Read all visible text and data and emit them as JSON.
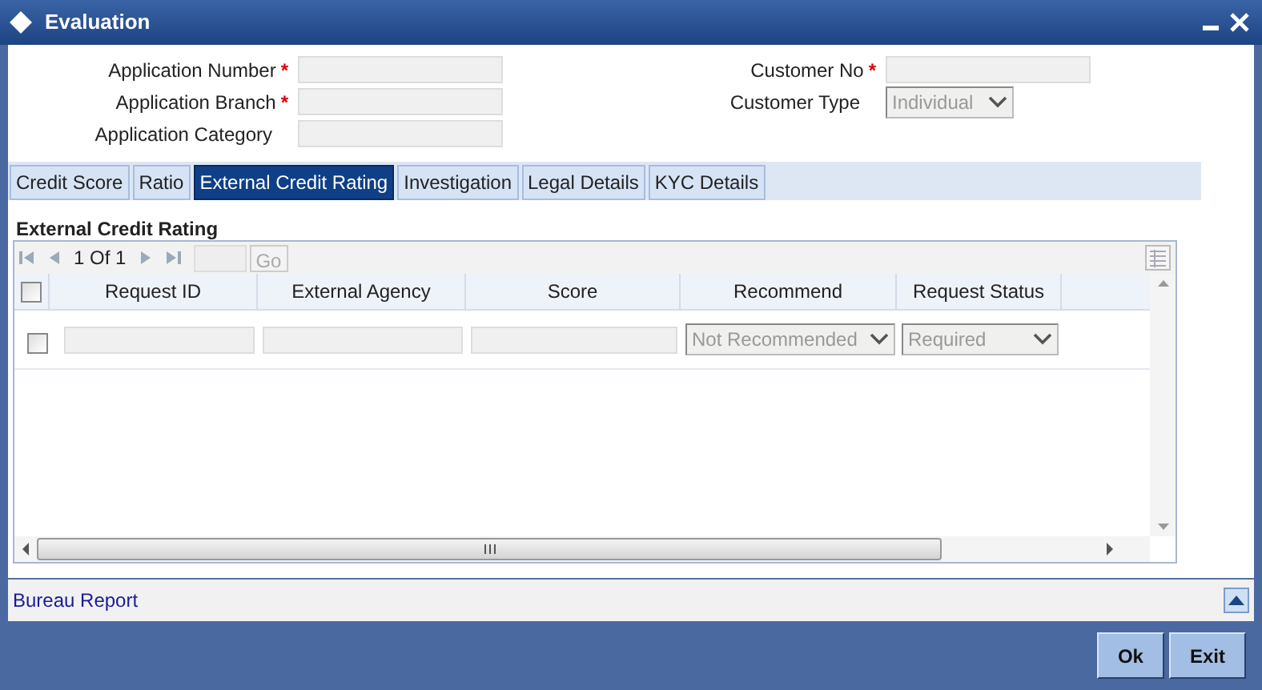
{
  "window": {
    "title": "Evaluation"
  },
  "fields_left": [
    {
      "label": "Application Number",
      "required_mark": "*",
      "kind": "text"
    },
    {
      "label": "Application Branch",
      "required_mark": "*",
      "kind": "text"
    },
    {
      "label": "Application Category",
      "kind": "text"
    }
  ],
  "fields_right": [
    {
      "label": "Customer No",
      "required_mark": "*",
      "kind": "text"
    },
    {
      "label": "Customer Type",
      "kind": "select",
      "value": "Individual",
      "disabled": true
    }
  ],
  "tabs": [
    {
      "label": "Credit Score",
      "selected": false
    },
    {
      "label": "Ratio",
      "selected": false
    },
    {
      "label": "External Credit Rating",
      "selected": true
    },
    {
      "label": "Investigation",
      "selected": false
    },
    {
      "label": "Legal Details",
      "selected": false
    },
    {
      "label": "KYC Details",
      "selected": false
    }
  ],
  "section_title": "External Credit Rating",
  "pager": {
    "text": "1 Of 1",
    "go": "Go"
  },
  "table": {
    "select_all_checked": false,
    "columns": [
      "Request ID",
      "External Agency",
      "Score",
      "Recommend",
      "Request Status"
    ],
    "rows": [
      {
        "checked": false,
        "cells": [
          {
            "kind": "text"
          },
          {
            "kind": "text"
          },
          {
            "kind": "text"
          },
          {
            "kind": "select",
            "value": "Not Recommended",
            "disabled": true
          },
          {
            "kind": "select",
            "value": "Required",
            "disabled": true
          }
        ]
      }
    ]
  },
  "footer_link": "Bureau Report",
  "buttons": [
    "Ok",
    "Exit"
  ]
}
